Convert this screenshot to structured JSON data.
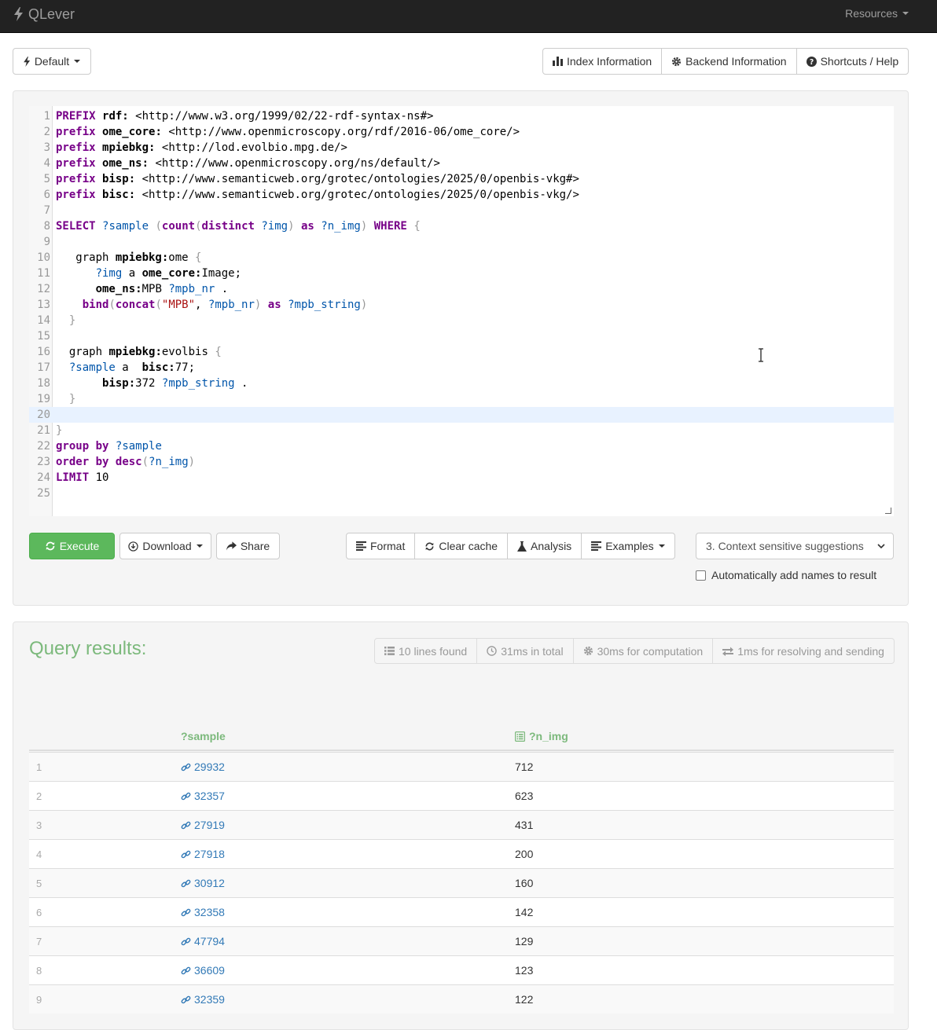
{
  "navbar": {
    "brand": "QLever",
    "resources_label": "Resources"
  },
  "toolbar": {
    "backend_label": "Default",
    "index_info_label": "Index Information",
    "backend_info_label": "Backend Information",
    "shortcuts_label": "Shortcuts / Help"
  },
  "editor": {
    "line_numbers": [
      "1",
      "2",
      "3",
      "4",
      "5",
      "6",
      "7",
      "8",
      "9",
      "10",
      "11",
      "12",
      "13",
      "14",
      "15",
      "16",
      "17",
      "18",
      "19",
      "20",
      "21",
      "22",
      "23",
      "24",
      "25"
    ],
    "lines": [
      "PREFIX rdf: <http://www.w3.org/1999/02/22-rdf-syntax-ns#>",
      "prefix ome_core: <http://www.openmicroscopy.org/rdf/2016-06/ome_core/>",
      "prefix mpiebkg: <http://lod.evolbio.mpg.de/>",
      "prefix ome_ns: <http://www.openmicroscopy.org/ns/default/>",
      "prefix bisp: <http://www.semanticweb.org/grotec/ontologies/2025/0/openbis-vkg#>",
      "prefix bisc: <http://www.semanticweb.org/grotec/ontologies/2025/0/openbis-vkg/>",
      "",
      "SELECT ?sample (count(distinct ?img) as ?n_img) WHERE {",
      "",
      "   graph mpiebkg:ome {",
      "      ?img a ome_core:Image;",
      "      ome_ns:MPB ?mpb_nr .",
      "    bind(concat(\"MPB\", ?mpb_nr) as ?mpb_string)",
      "  }",
      "",
      "  graph mpiebkg:evolbis {",
      "  ?sample a  bisc:77;",
      "       bisp:372 ?mpb_string .",
      "  }",
      "",
      "}",
      "group by ?sample",
      "order by desc(?n_img)",
      "LIMIT 10",
      ""
    ]
  },
  "actions": {
    "execute_label": "Execute",
    "download_label": "Download",
    "share_label": "Share",
    "format_label": "Format",
    "clear_cache_label": "Clear cache",
    "analysis_label": "Analysis",
    "examples_label": "Examples",
    "suggestions_selected": "3. Context sensitive suggestions",
    "auto_names_label": "Automatically add names to result"
  },
  "results": {
    "title": "Query results:",
    "stats": {
      "lines_found": "10 lines found",
      "total_time": "31ms in total",
      "computation_time": "30ms for computation",
      "resolve_time": "1ms for resolving and sending"
    },
    "columns": [
      "?sample",
      "?n_img"
    ],
    "rows": [
      {
        "idx": "1",
        "sample": "29932",
        "n_img": "712"
      },
      {
        "idx": "2",
        "sample": "32357",
        "n_img": "623"
      },
      {
        "idx": "3",
        "sample": "27919",
        "n_img": "431"
      },
      {
        "idx": "4",
        "sample": "27918",
        "n_img": "200"
      },
      {
        "idx": "5",
        "sample": "30912",
        "n_img": "160"
      },
      {
        "idx": "6",
        "sample": "32358",
        "n_img": "142"
      },
      {
        "idx": "7",
        "sample": "47794",
        "n_img": "129"
      },
      {
        "idx": "8",
        "sample": "36609",
        "n_img": "123"
      },
      {
        "idx": "9",
        "sample": "32359",
        "n_img": "122"
      }
    ]
  },
  "colors": {
    "success": "#5cb85c",
    "results_green": "#7cb97c",
    "link": "#337ab7",
    "keyword": "#770088",
    "variable": "#0055aa",
    "string": "#aa1111"
  }
}
